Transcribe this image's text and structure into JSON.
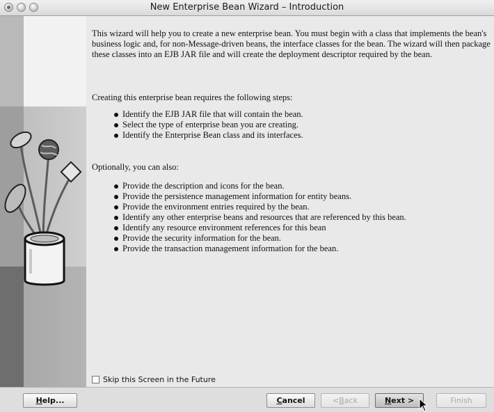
{
  "window": {
    "title": "New Enterprise Bean Wizard – Introduction"
  },
  "content": {
    "intro": "This wizard will help you to create a new enterprise bean. You must begin with a class that implements the bean's business logic and, for non-Message-driven beans, the interface classes for the bean. The wizard will then package these classes into an EJB JAR file and will create the deployment descriptor required by the bean.",
    "steps_heading": "Creating this enterprise bean requires the following steps:",
    "steps": [
      "Identify the EJB JAR file that will contain the bean.",
      "Select the type of enterprise bean you are creating.",
      "Identify the Enterprise Bean class and its interfaces."
    ],
    "optional_heading": "Optionally, you can also:",
    "optional": [
      "Provide the description and icons for the bean.",
      "Provide the persistence management information for entity beans.",
      "Provide the environment entries required by the bean.",
      "Identify any other enterprise beans and resources that are referenced by this bean.",
      "Identify any resource environment references for this bean",
      "Provide the security information for the bean.",
      "Provide the transaction management information for the bean."
    ],
    "skip_label": "Skip this Screen in the Future",
    "skip_checked": false
  },
  "buttons": {
    "help": {
      "label": "Help...",
      "mnemonic": "H",
      "rest": "elp..."
    },
    "cancel": {
      "label": "Cancel",
      "mnemonic": "C",
      "rest": "ancel"
    },
    "back": {
      "label": "< Back",
      "prefix": "< ",
      "mnemonic": "B",
      "rest": "ack"
    },
    "next": {
      "label": "Next >",
      "mnemonic": "N",
      "rest": "ext >"
    },
    "finish": {
      "label": "Finish"
    }
  },
  "icons": {
    "traffic_lights": [
      "close-icon",
      "minimize-icon",
      "maximize-icon"
    ],
    "wizard_art": "enterprise-bean-jar-illustration",
    "pointer": "mouse-pointer-icon"
  }
}
